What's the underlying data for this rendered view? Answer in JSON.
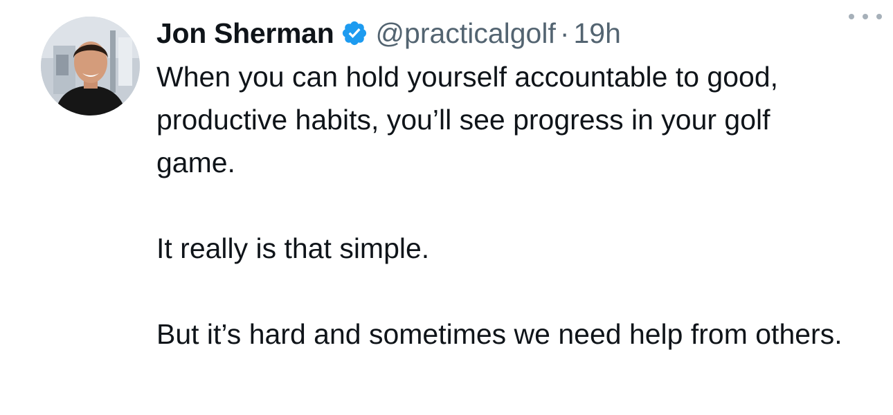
{
  "tweet": {
    "author_name": "Jon Sherman",
    "verified_icon": "verified-badge-icon",
    "handle": "@practicalgolf",
    "separator": "·",
    "time": "19h",
    "more_icon": "more-options-icon",
    "paragraphs": [
      "When you can hold yourself accountable to good, productive habits, you’ll see progress in your golf game.",
      "It really is that simple.",
      "But it’s hard and sometimes we need help from others."
    ]
  },
  "colors": {
    "text": "#0f1419",
    "secondary_text": "#536471",
    "verified_blue": "#1d9bf0",
    "background": "#ffffff"
  }
}
